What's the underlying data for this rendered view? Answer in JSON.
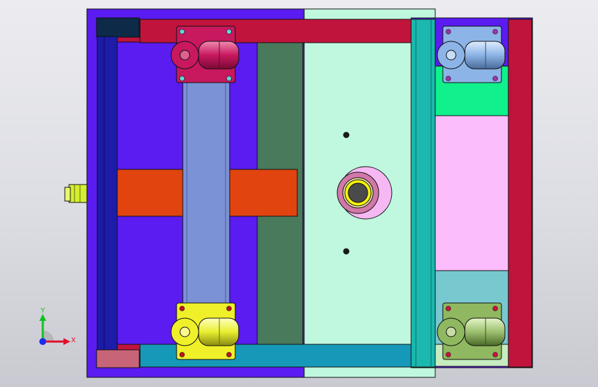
{
  "app": {
    "view": "cad-3d-viewport"
  },
  "colors": {
    "base_blue": "#5a1cf0",
    "mint_plate": "#bff8de",
    "crimson_rail": "#c0143c",
    "dark_rail": "#1c1ca8",
    "orange_bar": "#e1440f",
    "olive_block": "#4a7a5c",
    "teal_strip": "#1ab8ae",
    "steel_column": "#7c92d6",
    "pink_panel": "#fcbdfc",
    "green_panel": "#10f08c",
    "cyan_panel": "#78c8d0",
    "bottom_teal": "#1699b8"
  },
  "triad": {
    "x_label": "X",
    "y_label": "Y",
    "x_color": "#e0102a",
    "y_color": "#10c020",
    "z_color": "#1a2aee"
  },
  "casters": [
    {
      "name": "caster-top-left",
      "color": "#c8185e"
    },
    {
      "name": "caster-top-right",
      "color": "#8cb4e6"
    },
    {
      "name": "caster-bottom-left",
      "color": "#f0f02a"
    },
    {
      "name": "caster-bottom-right",
      "color": "#90b860"
    }
  ]
}
